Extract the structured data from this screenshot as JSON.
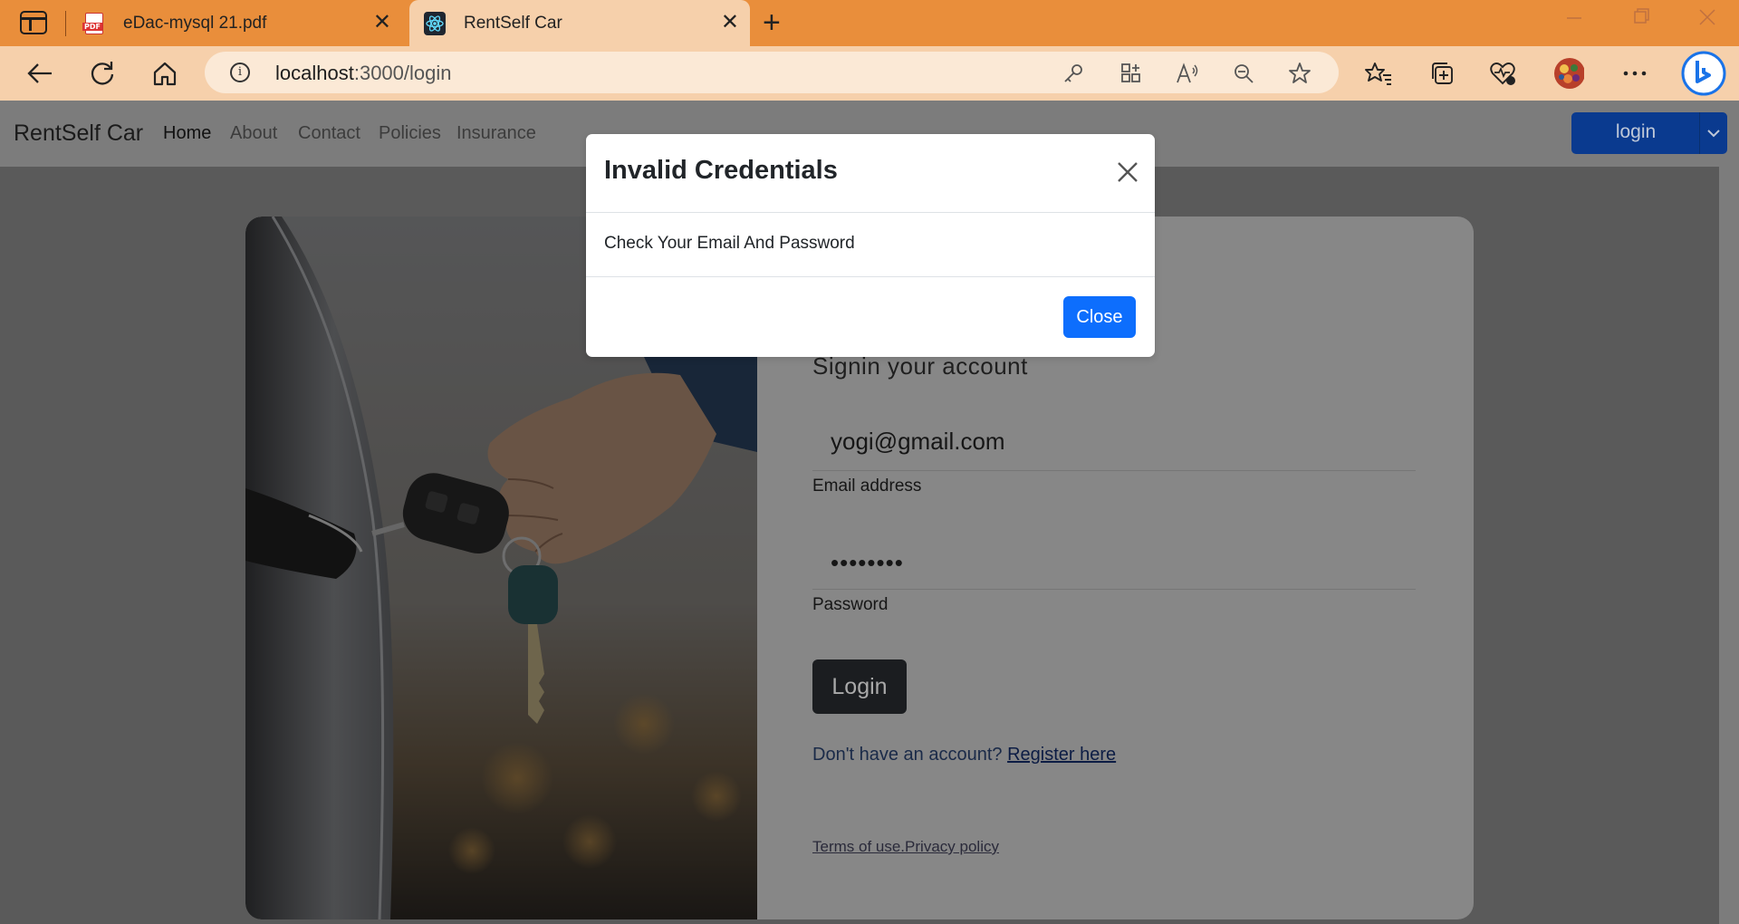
{
  "browser": {
    "tabs": [
      {
        "title": "eDac-mysql 21.pdf",
        "icon": "pdf-icon",
        "active": false
      },
      {
        "title": "RentSelf Car",
        "icon": "react-icon",
        "active": true
      }
    ],
    "address": {
      "host": "localhost",
      "path": ":3000/login"
    }
  },
  "app": {
    "brand": "RentSelf Car",
    "nav": [
      "Home",
      "About",
      "Contact",
      "Policies",
      "Insurance"
    ],
    "login_dropdown": "login"
  },
  "form": {
    "title": "Signin your account",
    "email_value": "yogi@gmail.com",
    "email_label": "Email address",
    "password_value": "••••••••",
    "password_label": "Password",
    "login_button": "Login",
    "register_prompt": "Don't have an account?",
    "register_link": "Register here",
    "terms": "Terms of use.",
    "privacy": "Privacy policy"
  },
  "modal": {
    "title": "Invalid Credentials",
    "body": "Check Your Email And Password",
    "close_button": "Close"
  },
  "colors": {
    "tab_bar": "#e98e3b",
    "active_tab": "#f6d0ab",
    "primary": "#0d6efd"
  }
}
